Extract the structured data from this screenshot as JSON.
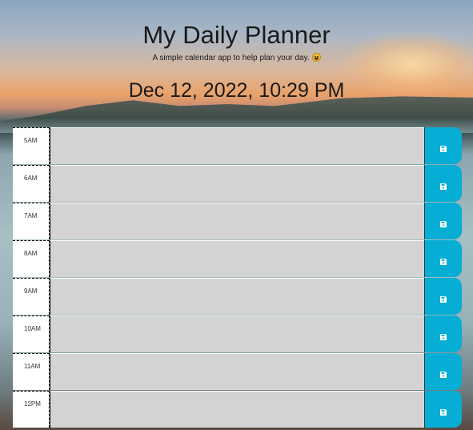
{
  "header": {
    "title": "My Daily Planner",
    "subtitle": "A simple calendar app to help plan your day.",
    "subtitle_emoji": "smiley-face-icon",
    "current_datetime": "Dec 12, 2022, 10:29 PM"
  },
  "time_blocks": [
    {
      "hour": "5AM",
      "description": ""
    },
    {
      "hour": "6AM",
      "description": ""
    },
    {
      "hour": "7AM",
      "description": ""
    },
    {
      "hour": "8AM",
      "description": ""
    },
    {
      "hour": "9AM",
      "description": ""
    },
    {
      "hour": "10AM",
      "description": ""
    },
    {
      "hour": "11AM",
      "description": ""
    },
    {
      "hour": "12PM",
      "description": ""
    }
  ],
  "save_icon": "floppy-disk-icon",
  "colors": {
    "save_button": "#06aed5",
    "description_bg": "#d3d3d3",
    "hour_bg": "#ffffff",
    "save_icon": "#ffffff"
  }
}
